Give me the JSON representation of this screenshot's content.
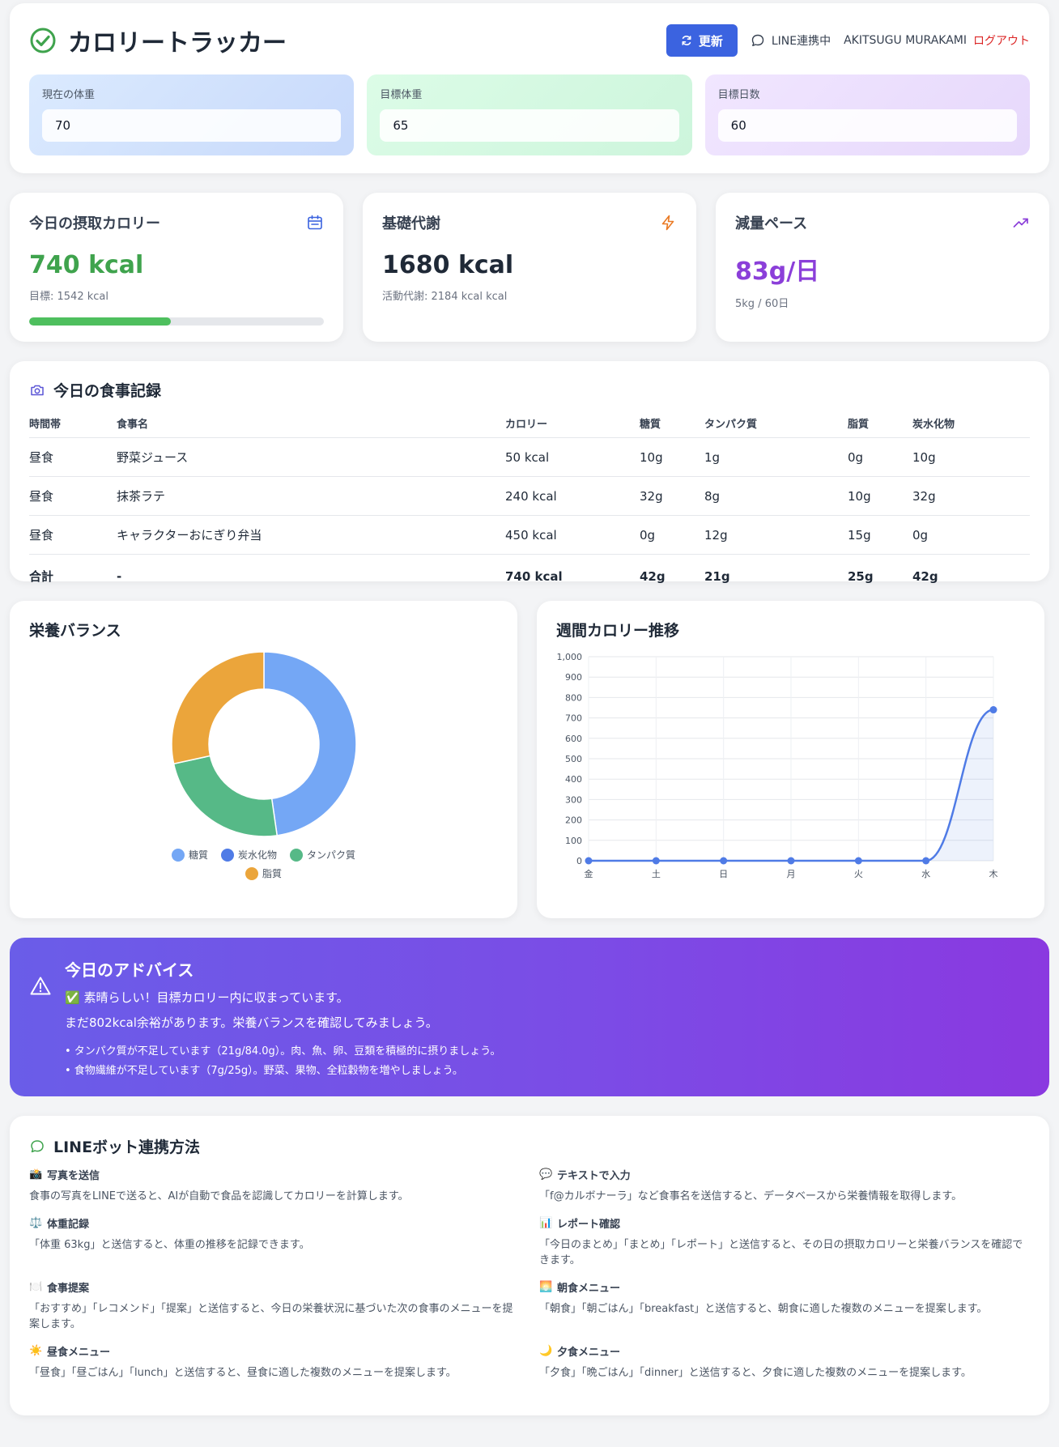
{
  "header": {
    "title": "カロリートラッカー",
    "refresh_label": "更新",
    "line_status": "LINE連携中",
    "user_name": "AKITSUGU MURAKAMI",
    "logout_label": "ログアウト"
  },
  "goals": [
    {
      "label": "現在の体重",
      "value": "70"
    },
    {
      "label": "目標体重",
      "value": "65"
    },
    {
      "label": "目標日数",
      "value": "60"
    }
  ],
  "stats": {
    "intake": {
      "title": "今日の摂取カロリー",
      "value": "740 kcal",
      "sub": "目標: 1542 kcal",
      "progress": 0.48,
      "color": "#3fa34d"
    },
    "bmr": {
      "title": "基礎代謝",
      "value": "1680 kcal",
      "sub": "活動代謝: 2184 kcal kcal",
      "color": "#1f2937"
    },
    "pace": {
      "title": "減量ペース",
      "value": "83g/日",
      "sub": "5kg / 60日",
      "color": "#8b3fd9"
    }
  },
  "meals": {
    "title": "今日の食事記録",
    "columns": [
      "時間帯",
      "食事名",
      "カロリー",
      "糖質",
      "タンパク質",
      "脂質",
      "炭水化物"
    ],
    "rows": [
      [
        "昼食",
        "野菜ジュース",
        "50 kcal",
        "10g",
        "1g",
        "0g",
        "10g"
      ],
      [
        "昼食",
        "抹茶ラテ",
        "240 kcal",
        "32g",
        "8g",
        "10g",
        "32g"
      ],
      [
        "昼食",
        "キャラクターおにぎり弁当",
        "450 kcal",
        "0g",
        "12g",
        "15g",
        "0g"
      ]
    ],
    "total": [
      "合計",
      "-",
      "740 kcal",
      "42g",
      "21g",
      "25g",
      "42g"
    ]
  },
  "chart_data": [
    {
      "type": "pie",
      "title": "栄養バランス",
      "categories": [
        "糖質",
        "炭水化物",
        "タンパク質",
        "脂質"
      ],
      "values": [
        42,
        0,
        21,
        25
      ],
      "colors": [
        "#74a7f5",
        "#4f7be6",
        "#56b987",
        "#eba53b"
      ]
    },
    {
      "type": "line",
      "title": "週間カロリー推移",
      "x": [
        "金",
        "土",
        "日",
        "月",
        "火",
        "水",
        "木"
      ],
      "series": [
        {
          "values": [
            0,
            0,
            0,
            0,
            0,
            0,
            740
          ]
        }
      ],
      "ylim": [
        0,
        1000
      ],
      "yticks": [
        "0",
        "100",
        "200",
        "300",
        "400",
        "500",
        "600",
        "700",
        "800",
        "900",
        "1,000"
      ],
      "color": "#4f7be6",
      "grid": true
    }
  ],
  "advice": {
    "title": "今日のアドバイス",
    "line1": "✅ 素晴らしい！目標カロリー内に収まっています。",
    "line2": "まだ802kcal余裕があります。栄養バランスを確認してみましょう。",
    "items": [
      "• タンパク質が不足しています（21g/84.0g）。肉、魚、卵、豆類を積極的に摂りましょう。",
      "• 食物繊維が不足しています（7g/25g）。野菜、果物、全粒穀物を増やしましょう。"
    ]
  },
  "linebot": {
    "title": "LINEボット連携方法",
    "items": [
      {
        "icon": "📸",
        "title": "写真を送信",
        "desc": "食事の写真をLINEで送ると、AIが自動で食品を認識してカロリーを計算します。"
      },
      {
        "icon": "💬",
        "title": "テキストで入力",
        "desc": "「f@カルボナーラ」など食事名を送信すると、データベースから栄養情報を取得します。"
      },
      {
        "icon": "⚖️",
        "title": "体重記録",
        "desc": "「体重 63kg」と送信すると、体重の推移を記録できます。"
      },
      {
        "icon": "📊",
        "title": "レポート確認",
        "desc": "「今日のまとめ」「まとめ」「レポート」と送信すると、その日の摂取カロリーと栄養バランスを確認できます。"
      },
      {
        "icon": "🍽️",
        "title": "食事提案",
        "desc": "「おすすめ」「レコメンド」「提案」と送信すると、今日の栄養状況に基づいた次の食事のメニューを提案します。"
      },
      {
        "icon": "🌅",
        "title": "朝食メニュー",
        "desc": "「朝食」「朝ごはん」「breakfast」と送信すると、朝食に適した複数のメニューを提案します。"
      },
      {
        "icon": "☀️",
        "title": "昼食メニュー",
        "desc": "「昼食」「昼ごはん」「lunch」と送信すると、昼食に適した複数のメニューを提案します。"
      },
      {
        "icon": "🌙",
        "title": "夕食メニュー",
        "desc": "「夕食」「晩ごはん」「dinner」と送信すると、夕食に適した複数のメニューを提案します。"
      }
    ]
  }
}
